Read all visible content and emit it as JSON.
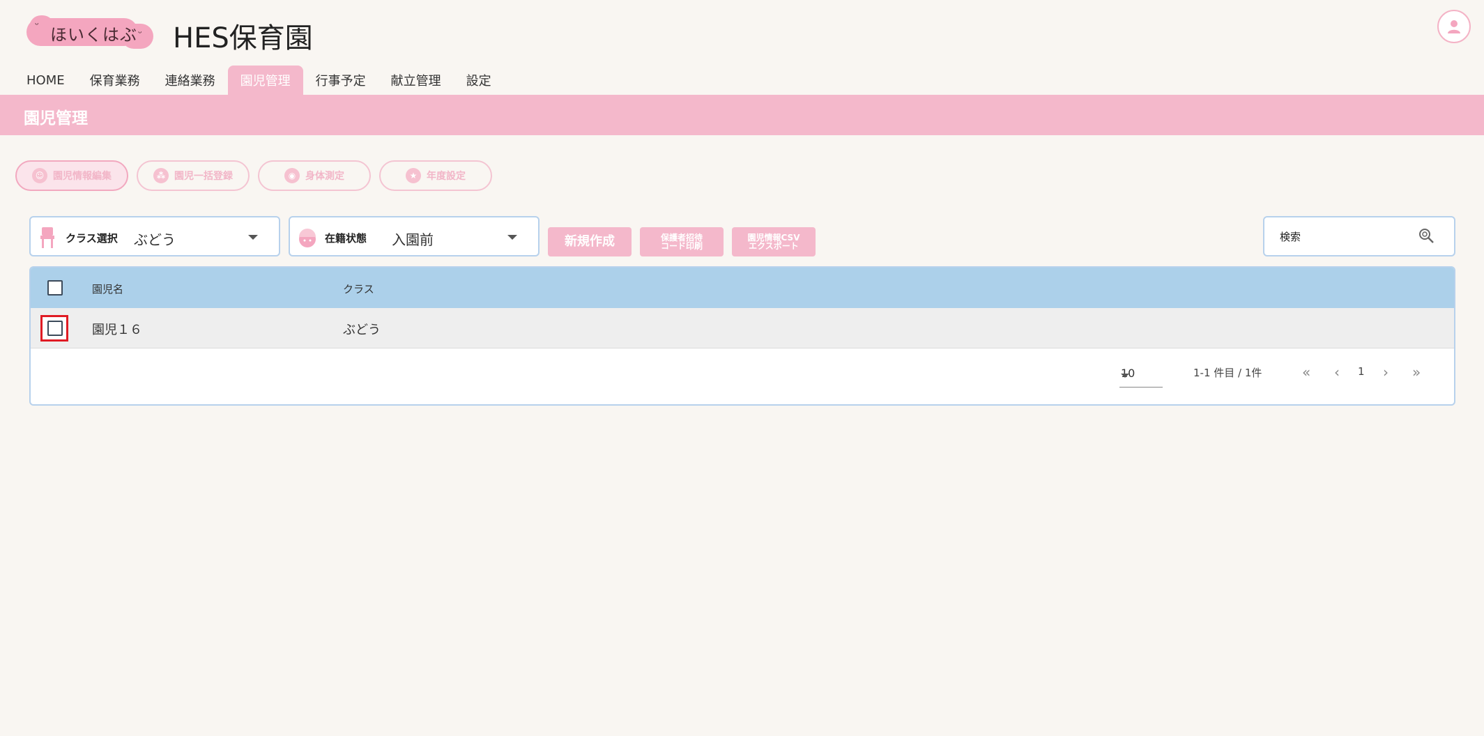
{
  "header": {
    "logo_text": "ほいくはぶ",
    "title": "HES保育園"
  },
  "nav": {
    "tabs": [
      {
        "label": "HOME"
      },
      {
        "label": "保育業務"
      },
      {
        "label": "連絡業務"
      },
      {
        "label": "園児管理",
        "active": true
      },
      {
        "label": "行事予定"
      },
      {
        "label": "献立管理"
      },
      {
        "label": "設定"
      }
    ]
  },
  "band": {
    "title": "園児管理"
  },
  "subnav": {
    "items": [
      {
        "label": "園児情報編集",
        "icon": "child-face-icon",
        "active": true
      },
      {
        "label": "園児一括登録",
        "icon": "group-icon"
      },
      {
        "label": "身体測定",
        "icon": "measure-icon"
      },
      {
        "label": "年度設定",
        "icon": "star-icon"
      }
    ]
  },
  "filters": {
    "class_label": "クラス選択",
    "class_value": "ぶどう",
    "status_label": "在籍状態",
    "status_value": "入園前"
  },
  "actions": {
    "create": "新規作成",
    "print_line1": "保護者招待",
    "print_line2": "コード印刷",
    "export_line1": "園児情報CSV",
    "export_line2": "エクスポート"
  },
  "search": {
    "placeholder": "検索"
  },
  "table": {
    "headers": [
      "園児名",
      "クラス"
    ],
    "rows": [
      {
        "name": "園児１６",
        "class": "ぶどう"
      }
    ]
  },
  "pagination": {
    "per_page": "10",
    "range": "1-1 件目 / 1件",
    "page": "1"
  },
  "colors": {
    "accent_pink": "#f4b8cb",
    "header_blue": "#acd0ea",
    "highlight_red": "#e01b24"
  }
}
